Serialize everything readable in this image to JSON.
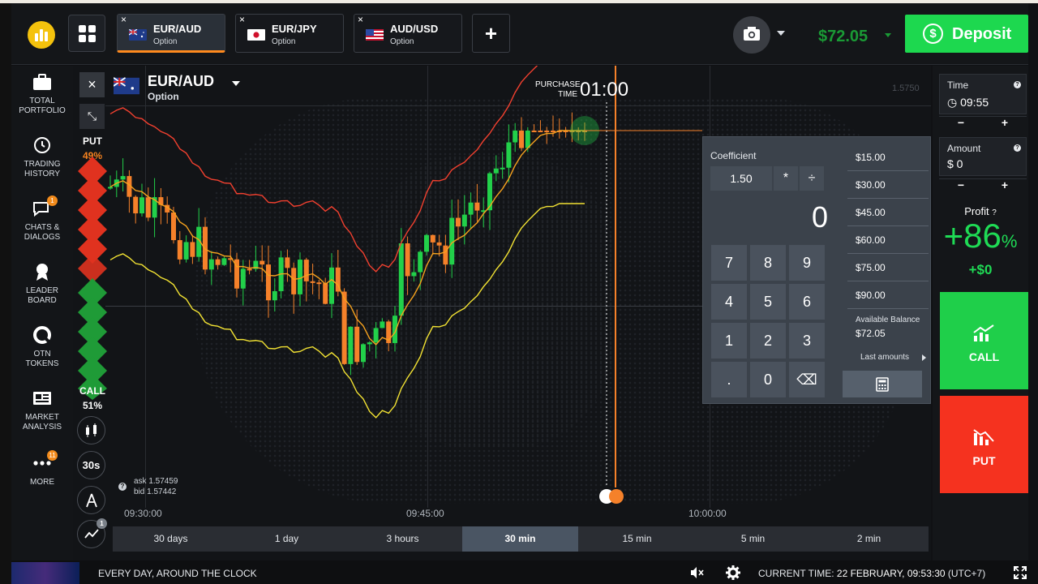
{
  "header": {
    "tabs": [
      {
        "pair": "EUR/AUD",
        "type": "Option",
        "active": true
      },
      {
        "pair": "EUR/JPY",
        "type": "Option",
        "active": false
      },
      {
        "pair": "AUD/USD",
        "type": "Option",
        "active": false
      }
    ],
    "add_tab": "+",
    "close_glyph": "×",
    "balance": "$72.05",
    "deposit_label": "Deposit"
  },
  "sidebar": {
    "items": [
      {
        "label_1": "TOTAL",
        "label_2": "PORTFOLIO",
        "icon": "portfolio-icon"
      },
      {
        "label_1": "TRADING",
        "label_2": "HISTORY",
        "icon": "history-icon"
      },
      {
        "label_1": "CHATS &",
        "label_2": "DIALOGS",
        "icon": "chat-icon",
        "badge": "1"
      },
      {
        "label_1": "LEADER",
        "label_2": "BOARD",
        "icon": "leaderboard-icon"
      },
      {
        "label_1": "OTN",
        "label_2": "TOKENS",
        "icon": "otn-token-icon"
      },
      {
        "label_1": "MARKET",
        "label_2": "ANALYSIS",
        "icon": "market-analysis-icon"
      },
      {
        "label_1": "MORE",
        "label_2": "",
        "icon": "more-icon",
        "badge": "11"
      }
    ]
  },
  "chart": {
    "asset_name": "EUR/AUD",
    "asset_type": "Option",
    "put_label": "PUT",
    "put_percent": "49%",
    "call_label": "CALL",
    "call_percent": "51%",
    "timeframe_button": "30s",
    "indicator_badge": "1",
    "purchase_label_1": "PURCHASE",
    "purchase_label_2": "TIME",
    "purchase_time": "01:00",
    "price_scale_value": "1.5750",
    "ask": "ask 1.57459",
    "bid": "bid 1.57442",
    "x_labels": [
      "09:30:00",
      "09:45:00",
      "10:00:00"
    ],
    "periods": [
      "30 days",
      "1 day",
      "3 hours",
      "30 min",
      "15 min",
      "5 min",
      "2 min"
    ],
    "active_period": "30 min",
    "colors": {
      "bull": "#22d04a",
      "bear": "#f5812a",
      "upper_band": "#f2402f",
      "middle_band": "#f6a21e",
      "lower_band": "#f2e233"
    }
  },
  "calculator": {
    "coefficient_label": "Coefficient",
    "coefficient_value": "1.50",
    "multiply": "*",
    "divide": "÷",
    "display": "0",
    "keys": [
      "7",
      "8",
      "9",
      "4",
      "5",
      "6",
      "1",
      "2",
      "3",
      ".",
      "0",
      "⌫"
    ],
    "amounts": [
      "$15.00",
      "$30.00",
      "$45.00",
      "$60.00",
      "$75.00",
      "$90.00"
    ],
    "available_label": "Available Balance",
    "available_value": "$72.05",
    "last_amounts": "Last amounts"
  },
  "trade_panel": {
    "time_label": "Time",
    "time_value": "09:55",
    "amount_label": "Amount",
    "amount_value": "$ 0",
    "stepper_minus": "−",
    "stepper_plus": "+",
    "profit_label": "Profit",
    "profit_percent": "+86",
    "profit_percent_sign": "%",
    "profit_amount": "+$0",
    "call_label": "CALL",
    "put_label": "PUT",
    "call_color": "#1fcf4a",
    "put_color": "#f5321f"
  },
  "footer": {
    "ticker": "EVERY DAY, AROUND THE CLOCK",
    "current_time_label": "CURRENT TIME:",
    "current_time_value": "22 FEBRUARY, 09:53:30",
    "timezone": "(UTC+7)"
  }
}
